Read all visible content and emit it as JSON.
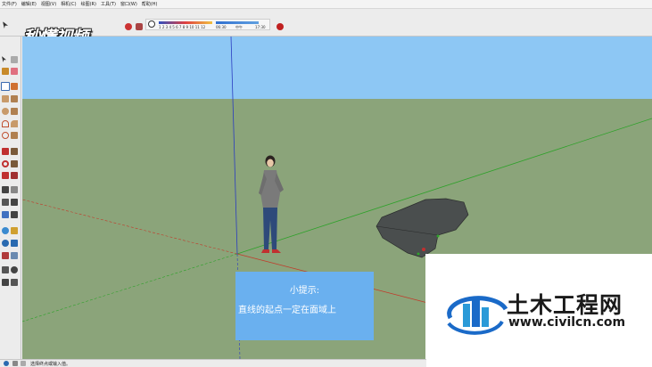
{
  "menu": {
    "items": [
      "文件(F)",
      "编辑(E)",
      "视图(V)",
      "相机(C)",
      "绘图(R)",
      "工具(T)",
      "窗口(W)",
      "帮助(H)"
    ]
  },
  "logo": {
    "text": "秒懂视频"
  },
  "shadow_panel": {
    "months": "1 2 3 4 5 6 7 8 9 10 11 12",
    "time_start": "06:30",
    "time_noon": "中午",
    "time_end": "17:30"
  },
  "tip": {
    "title": "小提示:",
    "body": "直线的起点一定在面域上"
  },
  "watermark": {
    "title": "土木工程网",
    "url": "www.civilcn.com"
  },
  "status": {
    "text": "选择终点或输入值。"
  },
  "colors": {
    "sky": "#8dc7f4",
    "ground": "#8ba47a",
    "tip_box": "#6ab0ef",
    "red_axis": "#c23a2a",
    "green_axis": "#2ea22a",
    "blue_axis": "#2a3cc0",
    "shape_fill": "#4a4e4e"
  },
  "icons": [
    "select-icon",
    "eraser-icon",
    "line-icon",
    "rectangle-icon",
    "circle-icon",
    "arc-icon",
    "push-pull-icon",
    "move-icon",
    "rotate-icon",
    "scale-icon",
    "tape-measure-icon",
    "orbit-icon",
    "pan-icon",
    "zoom-icon",
    "zoom-extents-icon",
    "paint-bucket-icon",
    "text-icon",
    "axes-icon",
    "camera-icon"
  ]
}
